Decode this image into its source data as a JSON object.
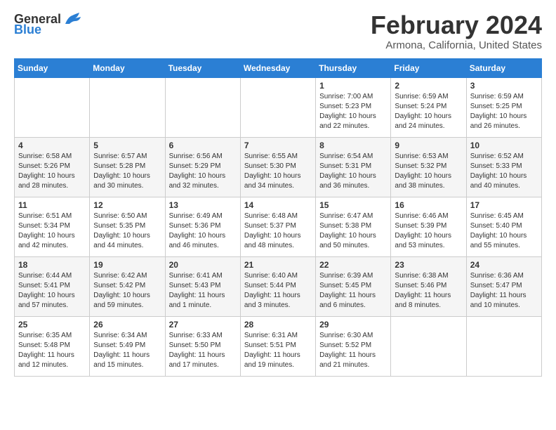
{
  "header": {
    "logo_general": "General",
    "logo_blue": "Blue",
    "month_title": "February 2024",
    "location": "Armona, California, United States"
  },
  "weekdays": [
    "Sunday",
    "Monday",
    "Tuesday",
    "Wednesday",
    "Thursday",
    "Friday",
    "Saturday"
  ],
  "weeks": [
    [
      {
        "day": "",
        "info": ""
      },
      {
        "day": "",
        "info": ""
      },
      {
        "day": "",
        "info": ""
      },
      {
        "day": "",
        "info": ""
      },
      {
        "day": "1",
        "info": "Sunrise: 7:00 AM\nSunset: 5:23 PM\nDaylight: 10 hours\nand 22 minutes."
      },
      {
        "day": "2",
        "info": "Sunrise: 6:59 AM\nSunset: 5:24 PM\nDaylight: 10 hours\nand 24 minutes."
      },
      {
        "day": "3",
        "info": "Sunrise: 6:59 AM\nSunset: 5:25 PM\nDaylight: 10 hours\nand 26 minutes."
      }
    ],
    [
      {
        "day": "4",
        "info": "Sunrise: 6:58 AM\nSunset: 5:26 PM\nDaylight: 10 hours\nand 28 minutes."
      },
      {
        "day": "5",
        "info": "Sunrise: 6:57 AM\nSunset: 5:28 PM\nDaylight: 10 hours\nand 30 minutes."
      },
      {
        "day": "6",
        "info": "Sunrise: 6:56 AM\nSunset: 5:29 PM\nDaylight: 10 hours\nand 32 minutes."
      },
      {
        "day": "7",
        "info": "Sunrise: 6:55 AM\nSunset: 5:30 PM\nDaylight: 10 hours\nand 34 minutes."
      },
      {
        "day": "8",
        "info": "Sunrise: 6:54 AM\nSunset: 5:31 PM\nDaylight: 10 hours\nand 36 minutes."
      },
      {
        "day": "9",
        "info": "Sunrise: 6:53 AM\nSunset: 5:32 PM\nDaylight: 10 hours\nand 38 minutes."
      },
      {
        "day": "10",
        "info": "Sunrise: 6:52 AM\nSunset: 5:33 PM\nDaylight: 10 hours\nand 40 minutes."
      }
    ],
    [
      {
        "day": "11",
        "info": "Sunrise: 6:51 AM\nSunset: 5:34 PM\nDaylight: 10 hours\nand 42 minutes."
      },
      {
        "day": "12",
        "info": "Sunrise: 6:50 AM\nSunset: 5:35 PM\nDaylight: 10 hours\nand 44 minutes."
      },
      {
        "day": "13",
        "info": "Sunrise: 6:49 AM\nSunset: 5:36 PM\nDaylight: 10 hours\nand 46 minutes."
      },
      {
        "day": "14",
        "info": "Sunrise: 6:48 AM\nSunset: 5:37 PM\nDaylight: 10 hours\nand 48 minutes."
      },
      {
        "day": "15",
        "info": "Sunrise: 6:47 AM\nSunset: 5:38 PM\nDaylight: 10 hours\nand 50 minutes."
      },
      {
        "day": "16",
        "info": "Sunrise: 6:46 AM\nSunset: 5:39 PM\nDaylight: 10 hours\nand 53 minutes."
      },
      {
        "day": "17",
        "info": "Sunrise: 6:45 AM\nSunset: 5:40 PM\nDaylight: 10 hours\nand 55 minutes."
      }
    ],
    [
      {
        "day": "18",
        "info": "Sunrise: 6:44 AM\nSunset: 5:41 PM\nDaylight: 10 hours\nand 57 minutes."
      },
      {
        "day": "19",
        "info": "Sunrise: 6:42 AM\nSunset: 5:42 PM\nDaylight: 10 hours\nand 59 minutes."
      },
      {
        "day": "20",
        "info": "Sunrise: 6:41 AM\nSunset: 5:43 PM\nDaylight: 11 hours\nand 1 minute."
      },
      {
        "day": "21",
        "info": "Sunrise: 6:40 AM\nSunset: 5:44 PM\nDaylight: 11 hours\nand 3 minutes."
      },
      {
        "day": "22",
        "info": "Sunrise: 6:39 AM\nSunset: 5:45 PM\nDaylight: 11 hours\nand 6 minutes."
      },
      {
        "day": "23",
        "info": "Sunrise: 6:38 AM\nSunset: 5:46 PM\nDaylight: 11 hours\nand 8 minutes."
      },
      {
        "day": "24",
        "info": "Sunrise: 6:36 AM\nSunset: 5:47 PM\nDaylight: 11 hours\nand 10 minutes."
      }
    ],
    [
      {
        "day": "25",
        "info": "Sunrise: 6:35 AM\nSunset: 5:48 PM\nDaylight: 11 hours\nand 12 minutes."
      },
      {
        "day": "26",
        "info": "Sunrise: 6:34 AM\nSunset: 5:49 PM\nDaylight: 11 hours\nand 15 minutes."
      },
      {
        "day": "27",
        "info": "Sunrise: 6:33 AM\nSunset: 5:50 PM\nDaylight: 11 hours\nand 17 minutes."
      },
      {
        "day": "28",
        "info": "Sunrise: 6:31 AM\nSunset: 5:51 PM\nDaylight: 11 hours\nand 19 minutes."
      },
      {
        "day": "29",
        "info": "Sunrise: 6:30 AM\nSunset: 5:52 PM\nDaylight: 11 hours\nand 21 minutes."
      },
      {
        "day": "",
        "info": ""
      },
      {
        "day": "",
        "info": ""
      }
    ]
  ]
}
